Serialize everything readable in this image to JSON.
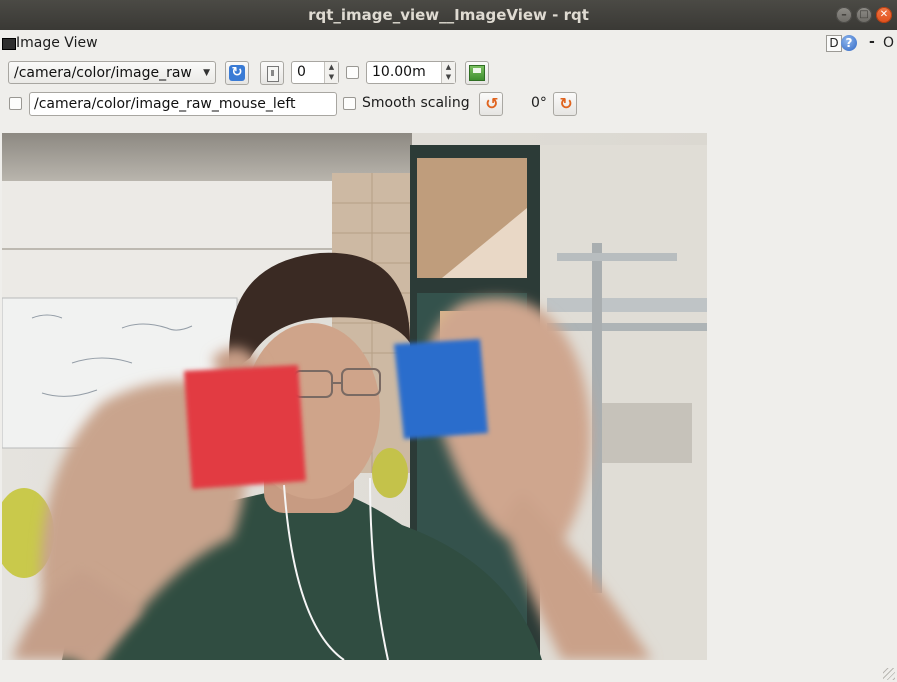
{
  "window": {
    "title": "rqt_image_view__ImageView - rqt"
  },
  "panel": {
    "title": "Image View",
    "help_d": "D",
    "help_q": "?",
    "dash": "-",
    "o": "O"
  },
  "toolbar": {
    "topic": "/camera/color/image_raw",
    "num_value": "0",
    "distance_value": "10.00m",
    "mouse_topic": "/camera/color/image_raw_mouse_left",
    "smooth_label": "Smooth scaling",
    "rotation": "0°"
  },
  "icons": {
    "refresh": "refresh-icon",
    "zoom1": "page-icon",
    "save": "save-icon",
    "rotate_left": "rotate-left-icon",
    "rotate_right": "rotate-right-icon"
  },
  "colors": {
    "title_bar": "#3c3b37",
    "close_button": "#e95420",
    "window_bg": "#efeeeb"
  }
}
